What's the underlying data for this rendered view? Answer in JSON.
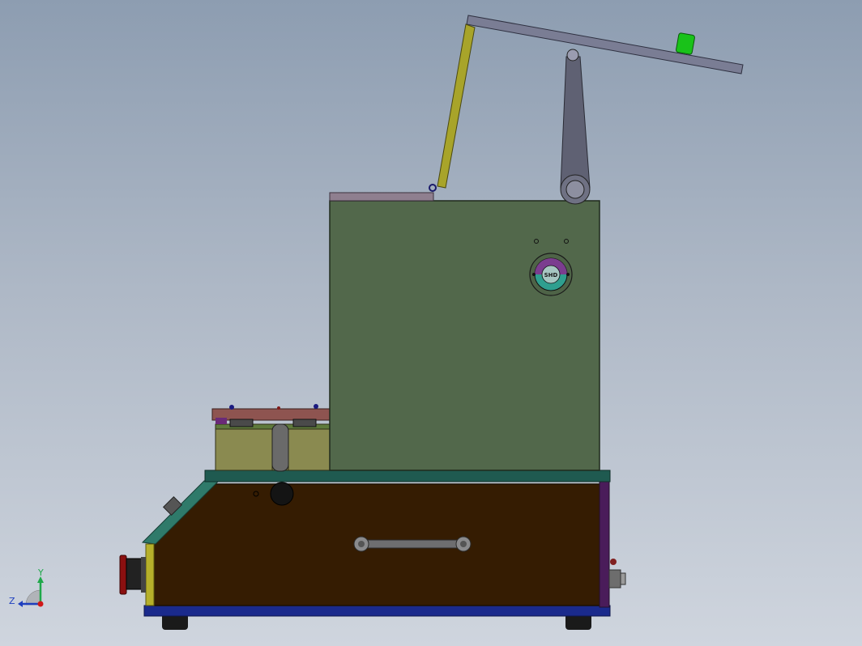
{
  "view": {
    "background_top": "#8d9db1",
    "background_bottom": "#cfd5de"
  },
  "triad": {
    "y_label": "Y",
    "z_label": "Z",
    "y_color": "#1fa84a",
    "z_color": "#1e3fbf",
    "origin_color": "#d01818"
  },
  "gauge": {
    "label": "SHD"
  },
  "colors": {
    "base_body": "#351c02",
    "base_bottom_strip": "#1a2a8c",
    "base_top_plate": "#1f5a50",
    "front_panel": "#b6b02a",
    "upper_cabinet": "#52684b",
    "lever_arm": "#7a7d94",
    "lever_link": "#a8a42a",
    "pivot_column": "#5f6173",
    "knob": "#19c219",
    "clamp_block": "#8a8a50",
    "clamp_top_plate": "#8e5450"
  }
}
